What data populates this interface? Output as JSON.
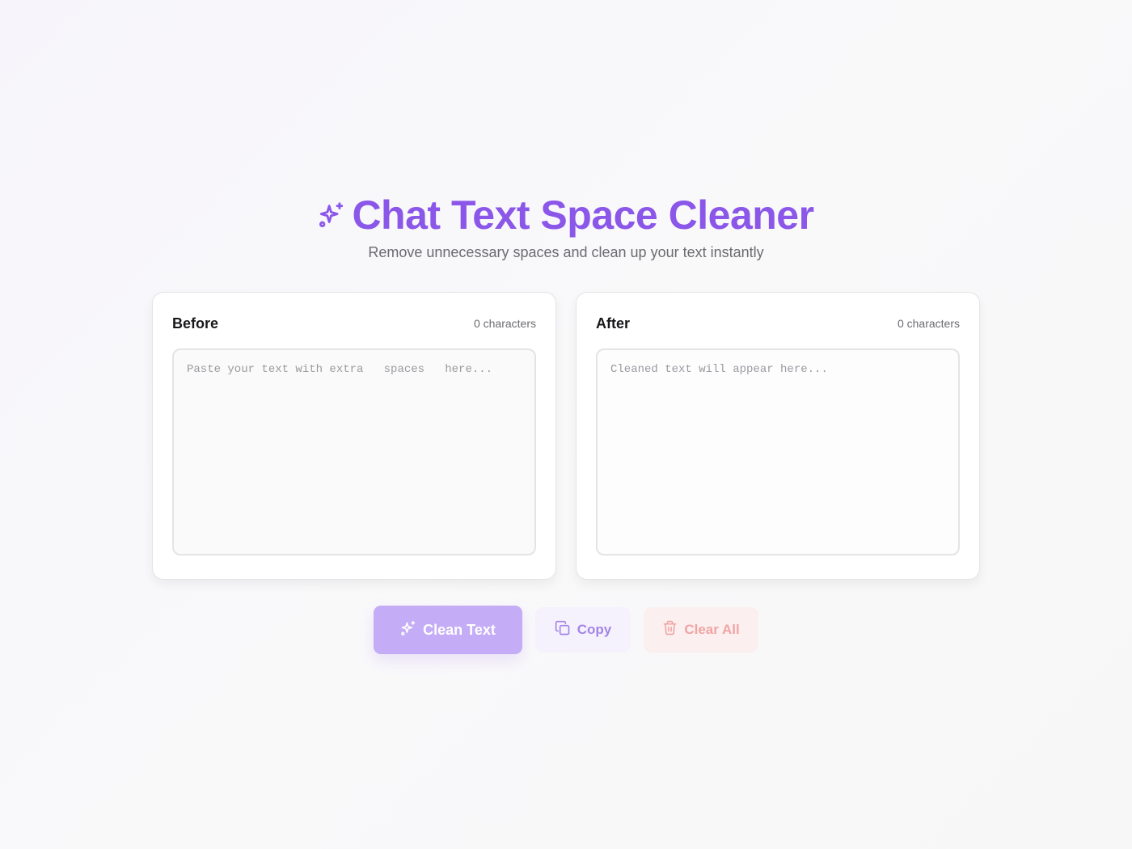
{
  "header": {
    "title": "Chat Text Space Cleaner",
    "subtitle": "Remove unnecessary spaces and clean up your text instantly",
    "icon": "sparkles-icon"
  },
  "before_panel": {
    "label": "Before",
    "count": "0 characters",
    "value": "",
    "placeholder": "Paste your text with extra   spaces   here..."
  },
  "after_panel": {
    "label": "After",
    "count": "0 characters",
    "value": "",
    "placeholder": "Cleaned text will appear here..."
  },
  "actions": {
    "clean_label": "Clean Text",
    "clean_icon": "sparkles-icon",
    "copy_label": "Copy",
    "copy_icon": "copy-icon",
    "clear_label": "Clear All",
    "clear_icon": "trash-icon"
  },
  "colors": {
    "accent": "#8b57e9",
    "clean_button_bg": "#c5acf7",
    "copy_button_bg": "#f6f2fd",
    "clear_button_bg": "#fbefef",
    "clear_text": "#f0a4a4"
  }
}
